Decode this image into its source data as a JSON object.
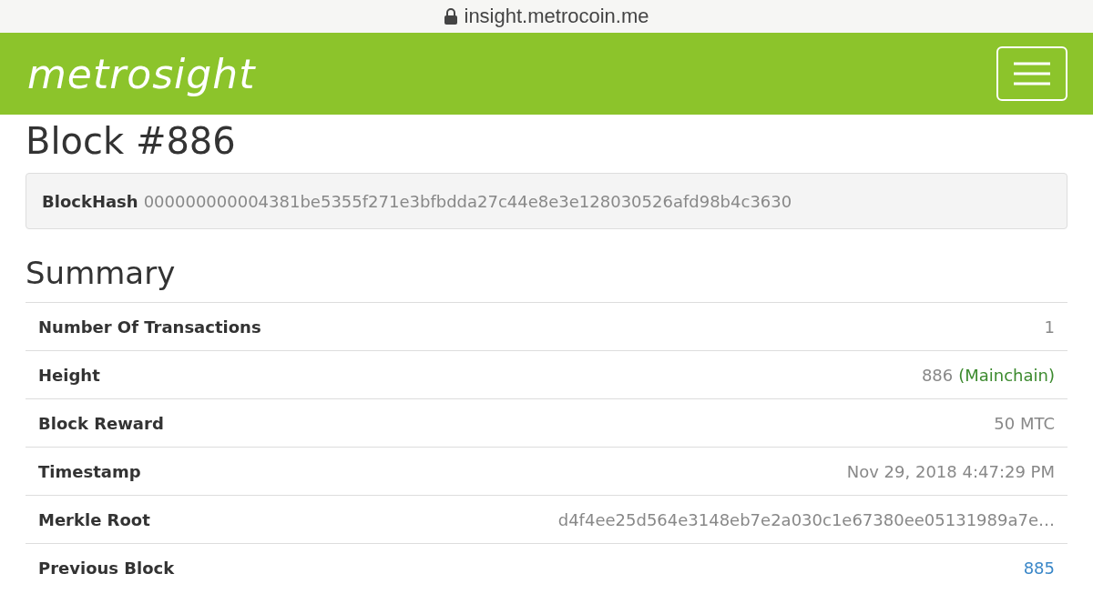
{
  "browser": {
    "url": "insight.metrocoin.me"
  },
  "header": {
    "logo": "metrosight"
  },
  "title": "Block #886",
  "block_hash": {
    "label": "BlockHash",
    "value": "000000000004381be5355f271e3bfbdda27c44e8e3e128030526afd98b4c3630"
  },
  "summary": {
    "heading": "Summary",
    "rows": [
      {
        "kind": "text",
        "label": "Number Of Transactions",
        "value": "1"
      },
      {
        "kind": "height",
        "label": "Height",
        "value": "886",
        "status": "(Mainchain)"
      },
      {
        "kind": "text",
        "label": "Block Reward",
        "value": "50 MTC"
      },
      {
        "kind": "text",
        "label": "Timestamp",
        "value": "Nov 29, 2018 4:47:29 PM"
      },
      {
        "kind": "text",
        "label": "Merkle Root",
        "value": "d4f4ee25d564e3148eb7e2a030c1e67380ee05131989a7e…"
      },
      {
        "kind": "link",
        "label": "Previous Block",
        "value": "885"
      }
    ]
  }
}
